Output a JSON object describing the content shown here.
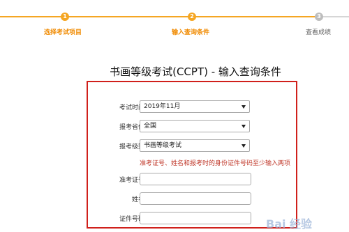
{
  "steps": [
    {
      "number": "1",
      "label": "选择考试项目",
      "state": "done"
    },
    {
      "number": "2",
      "label": "输入查询条件",
      "state": "active"
    },
    {
      "number": "3",
      "label": "查看成绩",
      "state": "pending"
    }
  ],
  "page_title": "书画等级考试(CCPT) - 输入查询条件",
  "form": {
    "exam_time": {
      "label": "考试时间:",
      "value": "2019年11月"
    },
    "province": {
      "label": "报考省份:",
      "value": "全国"
    },
    "level": {
      "label": "报考级别:",
      "value": "书画等级考试"
    },
    "hint": "准考证号、姓名和报考时的身份证件号码至少输入两项",
    "ticket_no": {
      "label": "准考证号:",
      "value": ""
    },
    "name": {
      "label": "姓名:",
      "value": ""
    },
    "id_no": {
      "label": "证件号码:",
      "value": ""
    }
  },
  "watermark": "Bai 经验",
  "colors": {
    "accent": "#f5a623",
    "border": "#d0201b",
    "hint": "#c0392b"
  }
}
